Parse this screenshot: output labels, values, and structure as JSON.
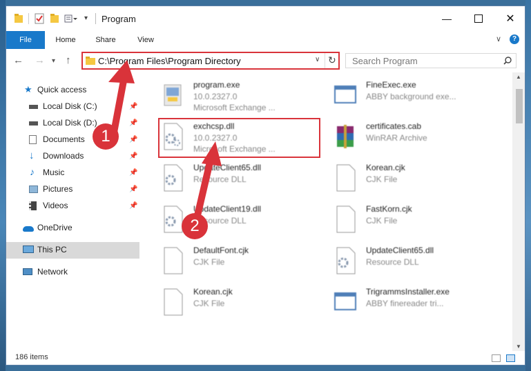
{
  "window": {
    "title": "Program",
    "controls": [
      "minimize-icon",
      "maximize-icon",
      "close-icon"
    ]
  },
  "ribbon": {
    "tabs": [
      "File",
      "Home",
      "Share",
      "View"
    ]
  },
  "address": {
    "path": "C:\\Program Files\\Program Directory",
    "search_placeholder": "Search Program"
  },
  "nav": {
    "items": [
      {
        "label": "Quick access",
        "icon": "star-icon"
      },
      {
        "label": "Local Disk (C:)",
        "icon": "drive-icon",
        "pinned": true
      },
      {
        "label": "Local Disk (D:)",
        "icon": "drive-icon",
        "pinned": true
      },
      {
        "label": "Documents",
        "icon": "documents-icon",
        "pinned": true
      },
      {
        "label": "Downloads",
        "icon": "download-icon",
        "pinned": true
      },
      {
        "label": "Music",
        "icon": "music-icon",
        "pinned": true
      },
      {
        "label": "Pictures",
        "icon": "pictures-icon",
        "pinned": true
      },
      {
        "label": "Videos",
        "icon": "videos-icon",
        "pinned": true
      },
      {
        "label": "OneDrive",
        "icon": "cloud-icon"
      },
      {
        "label": "This PC",
        "icon": "computer-icon",
        "selected": true
      },
      {
        "label": "Network",
        "icon": "network-icon"
      }
    ]
  },
  "files": [
    {
      "name": "program.exe",
      "line2": "10.0.2327.0",
      "line3": "Microsoft Exchange ...",
      "icon": "exe-icon"
    },
    {
      "name": "FineExec.exe",
      "line2": "ABBY background exe...",
      "line3": "",
      "icon": "app-window-icon"
    },
    {
      "name": "exchcsp.dll",
      "line2": "10.0.2327.0",
      "line3": "Microsoft Exchange ...",
      "icon": "dll-gear-icon"
    },
    {
      "name": "certificates.cab",
      "line2": "WinRAR Archive",
      "line3": "",
      "icon": "winrar-icon"
    },
    {
      "name": "UpdateClient65.dll",
      "line2": "Resource DLL",
      "line3": "",
      "icon": "dll-gear-icon"
    },
    {
      "name": "Korean.cjk",
      "line2": "CJK File",
      "line3": "",
      "icon": "blank-file-icon"
    },
    {
      "name": "UpdateClient19.dll",
      "line2": "Resource DLL",
      "line3": "",
      "icon": "dll-gear-icon"
    },
    {
      "name": "FastKorn.cjk",
      "line2": "CJK File",
      "line3": "",
      "icon": "blank-file-icon"
    },
    {
      "name": "DefaultFont.cjk",
      "line2": "CJK File",
      "line3": "",
      "icon": "blank-file-icon"
    },
    {
      "name": "UpdateClient65.dll",
      "line2": "Resource DLL",
      "line3": "",
      "icon": "dll-gear-icon"
    },
    {
      "name": "Korean.cjk",
      "line2": "CJK File",
      "line3": "",
      "icon": "blank-file-icon"
    },
    {
      "name": "TrigrammsInstaller.exe",
      "line2": "ABBY finereader tri...",
      "line3": "",
      "icon": "app-window-icon"
    }
  ],
  "status": {
    "count": "186 items"
  },
  "annotations": {
    "step1": "1",
    "step2": "2",
    "color": "#d9333a"
  }
}
